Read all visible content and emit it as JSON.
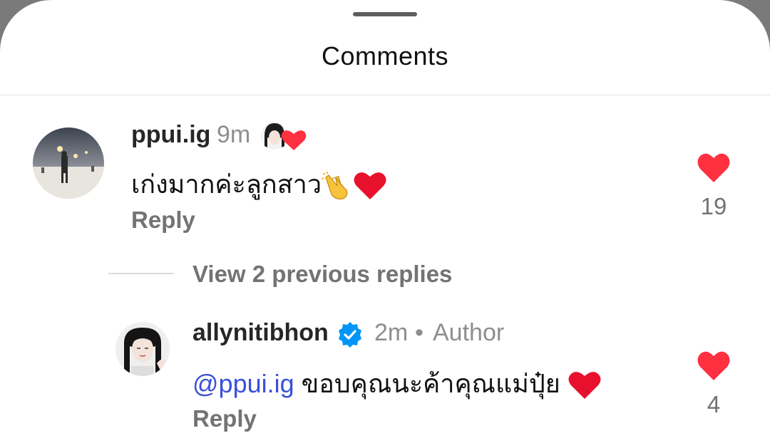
{
  "sheet": {
    "title": "Comments"
  },
  "comment": {
    "username": "ppui.ig",
    "time": "9m",
    "text": "เก่งมากค่ะลูกสาว",
    "reply_label": "Reply",
    "like_count": "19"
  },
  "view_replies": "View 2 previous replies",
  "reply": {
    "username": "allynitibhon",
    "time": "2m",
    "separator": "•",
    "author_label": "Author",
    "mention": "@ppui.ig",
    "text": "ขอบคุณนะค้าคุณแม่ปุ๋ย",
    "reply_label": "Reply",
    "like_count": "4"
  },
  "colors": {
    "heart": "#ff3040",
    "verified": "#0095f6",
    "mention": "#3a4fd8"
  }
}
